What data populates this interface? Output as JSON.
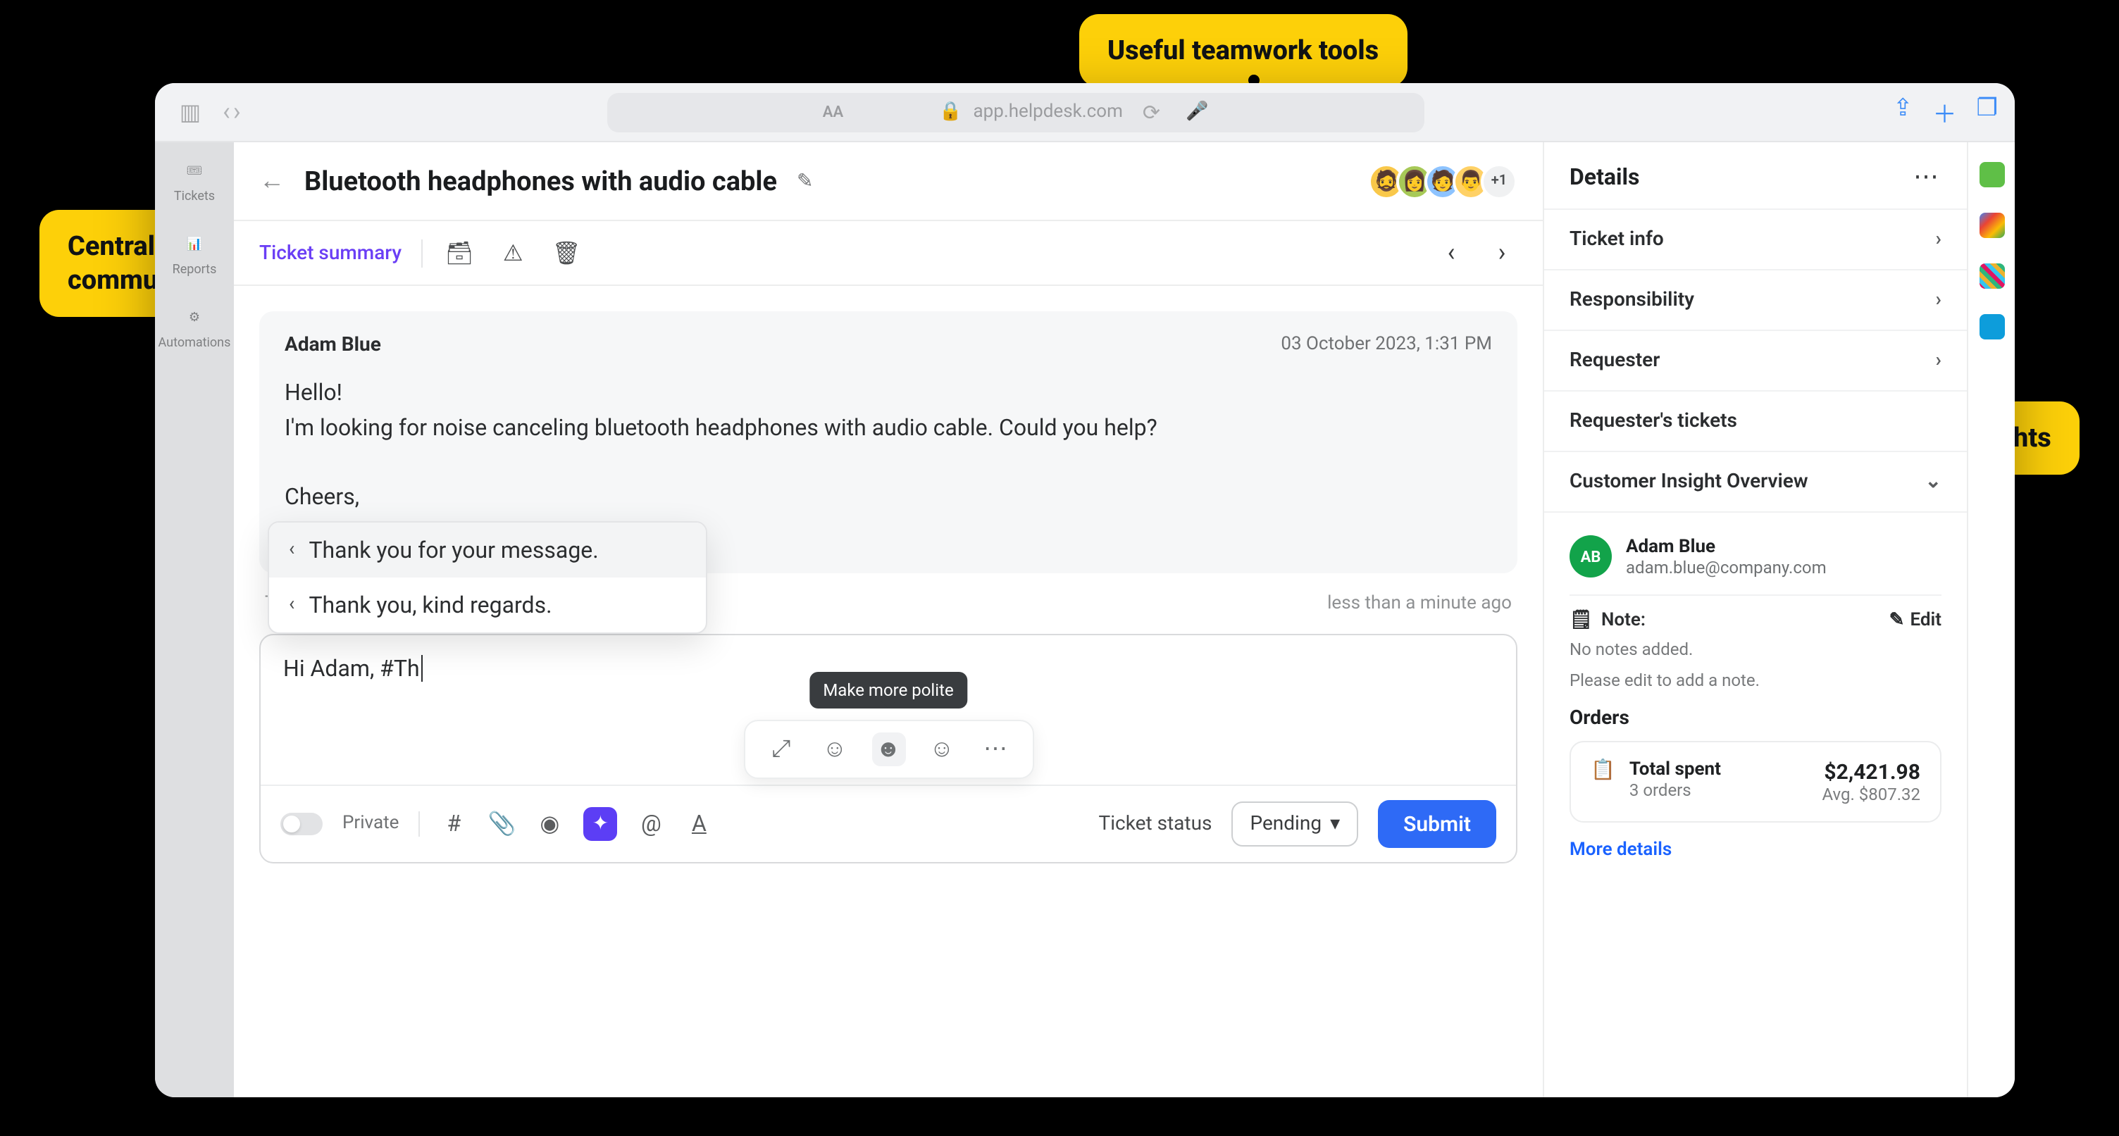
{
  "browser": {
    "url": "app.helpdesk.com"
  },
  "sidebar": {
    "items": [
      {
        "label": "Tickets"
      },
      {
        "label": "Reports"
      },
      {
        "label": "Automations"
      }
    ]
  },
  "header": {
    "title": "Bluetooth headphones with audio cable",
    "avatars_more": "+1"
  },
  "toolbar": {
    "summary": "Ticket summary"
  },
  "message": {
    "author": "Adam Blue",
    "timestamp": "03 October 2023, 1:31 PM",
    "body": "Hello!\nI'm looking for noise canceling bluetooth headphones with audio cable. Could you help?\n\nCheers,\nAdam"
  },
  "reply_meta": {
    "to_prefix": "To",
    "age": "less than a minute ago"
  },
  "suggestions": [
    "Thank you for your message.",
    "Thank you, kind regards."
  ],
  "composer": {
    "text_prefix": "Hi Adam, #Th",
    "tooltip": "Make more polite",
    "private_label": "Private",
    "status_label": "Ticket status",
    "status_value": "Pending",
    "submit": "Submit"
  },
  "details": {
    "title": "Details",
    "rows": [
      "Ticket info",
      "Responsibility",
      "Requester",
      "Requester's tickets"
    ],
    "insight_header": "Customer Insight Overview",
    "customer": {
      "initials": "AB",
      "name": "Adam Blue",
      "email": "adam.blue@company.com"
    },
    "note": {
      "label": "Note:",
      "edit": "Edit",
      "line1": "No notes added.",
      "line2": "Please edit to add a note."
    },
    "orders": {
      "header": "Orders",
      "total_label": "Total spent",
      "count": "3 orders",
      "total_value": "$2,421.98",
      "avg": "Avg. $807.32"
    },
    "more": "More details"
  },
  "callouts": {
    "c1a": "Centralized",
    "c1b": "communication",
    "c2": "Useful teamwork tools",
    "c3": "Customer insights"
  }
}
